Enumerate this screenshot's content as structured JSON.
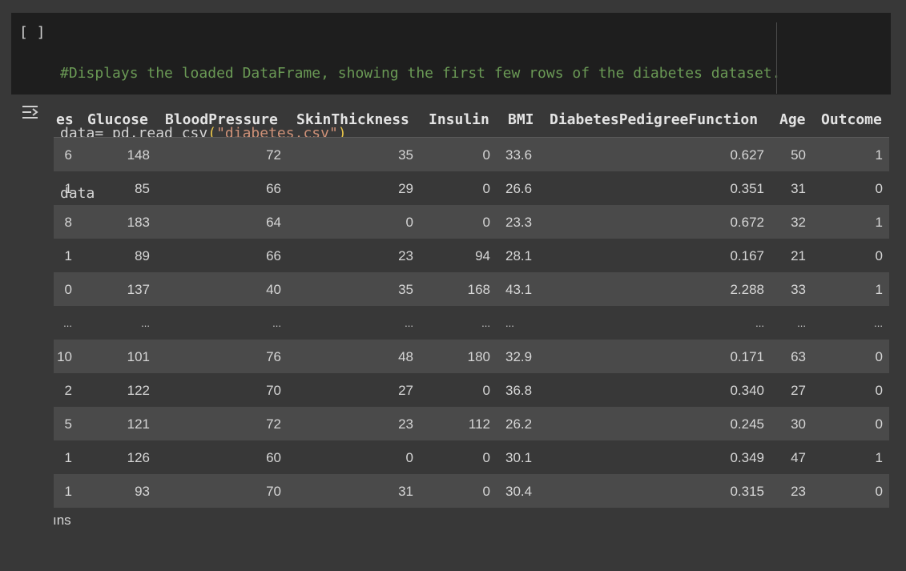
{
  "cell": {
    "run_bracket": "[ ]",
    "code_lines": [
      {
        "comment": "#Displays the loaded DataFrame, showing the first few rows of the diabetes dataset."
      },
      {
        "pre": "data= pd.read_csv",
        "open": "(",
        "str": "\"diabetes.csv\"",
        "close": ")"
      },
      {
        "plain": "data"
      }
    ]
  },
  "output": {
    "icon": "output-toggle-icon",
    "columns": [
      "es",
      "Glucose",
      "BloodPressure",
      "SkinThickness",
      "Insulin",
      "BMI",
      "DiabetesPedigreeFunction",
      "Age",
      "Outcome"
    ],
    "rows": [
      [
        "6",
        "148",
        "72",
        "35",
        "0",
        "33.6",
        "0.627",
        "50",
        "1"
      ],
      [
        "1",
        "85",
        "66",
        "29",
        "0",
        "26.6",
        "0.351",
        "31",
        "0"
      ],
      [
        "8",
        "183",
        "64",
        "0",
        "0",
        "23.3",
        "0.672",
        "32",
        "1"
      ],
      [
        "1",
        "89",
        "66",
        "23",
        "94",
        "28.1",
        "0.167",
        "21",
        "0"
      ],
      [
        "0",
        "137",
        "40",
        "35",
        "168",
        "43.1",
        "2.288",
        "33",
        "1"
      ],
      [
        "...",
        "...",
        "...",
        "...",
        "...",
        "...",
        "...",
        "...",
        "..."
      ],
      [
        "10",
        "101",
        "76",
        "48",
        "180",
        "32.9",
        "0.171",
        "63",
        "0"
      ],
      [
        "2",
        "122",
        "70",
        "27",
        "0",
        "36.8",
        "0.340",
        "27",
        "0"
      ],
      [
        "5",
        "121",
        "72",
        "23",
        "112",
        "26.2",
        "0.245",
        "30",
        "0"
      ],
      [
        "1",
        "126",
        "60",
        "0",
        "0",
        "30.1",
        "0.349",
        "47",
        "1"
      ],
      [
        "1",
        "93",
        "70",
        "31",
        "0",
        "30.4",
        "0.315",
        "23",
        "0"
      ]
    ],
    "footer": "ıns"
  }
}
